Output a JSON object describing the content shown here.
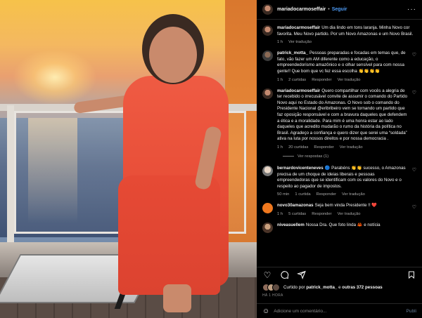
{
  "header": {
    "username": "mariadocarmoseffair",
    "separator": "•",
    "follow_label": "Seguir",
    "more_label": "···"
  },
  "comments": [
    {
      "username": "mariadocarmoseffair",
      "text": "Um dia lindo em tons laranja. Minha Novo cor favorita. Meu Novo partido. Por um Novo Amazonas e um Novo Brasil.",
      "time": "1 h",
      "likes": "",
      "reply_label": "",
      "translate_label": "Ver tradução",
      "avatar": "user"
    },
    {
      "username": "patrick_motta_",
      "text": "Pessoas preparadas e focadas em temas que, de fato, vão fazer um AM diferente como a educação, o empreendedorismo amazônico e o olhar sensível para com nossa gente!! Que bom que vc fez essa escolha 👏👏👏👏",
      "time": "1 h",
      "likes": "2 curtidas",
      "reply_label": "Responder",
      "translate_label": "Ver tradução",
      "avatar": "patrick"
    },
    {
      "username": "mariadocarmoseffair",
      "text": "Quero compartilhar com vocês a alegria de ter recebido o irrecusável convite de assumir o comando do Partido Novo aqui no Estado do Amazonas. O Novo sob o comando do Presidente Nacional @eribribeiro vem se tornando um partido que faz oposição responsável e com a bravura daqueles que defendem a ética e a moralidade. Para mim é uma honra estar ao lado daqueles que acredito mudarão o rumo da história da política no Brasil. Agradeço a confiança e quero dizer que serei uma “soldada” ativa na luta por nossos direitos e por nossa democracia .",
      "time": "1 h",
      "likes": "20 curtidas",
      "reply_label": "Responder",
      "translate_label": "Ver tradução",
      "avatar": "user"
    },
    {
      "username": "bernardovicenteneves",
      "text": "🔵 Parabéns 👏👏 sucesso, o Amazonas precisa de um choque de ideias liberais e pessoas empreendedoras que se identificam com os valores do Novo e o respeito ao pagador de impostos.",
      "time": "50 min",
      "likes": "1 curtida",
      "reply_label": "Responder",
      "translate_label": "Ver tradução",
      "avatar": "bernardo"
    },
    {
      "username": "novo30amazonas",
      "text": "Seja bem vinda Presidente !! ❤️",
      "time": "1 h",
      "likes": "5 curtidas",
      "reply_label": "Responder",
      "translate_label": "Ver tradução",
      "avatar": "novo"
    },
    {
      "username": "niveasuellem",
      "text": "Nossa Dra. Que foto linda 🦀 e notícia",
      "time": "",
      "likes": "",
      "reply_label": "",
      "translate_label": "",
      "avatar": "nivea"
    }
  ],
  "view_replies_label": "Ver respostas (1)",
  "actions": {
    "like_icon": "heart-icon",
    "comment_icon": "comment-icon",
    "share_icon": "share-icon",
    "save_icon": "bookmark-icon"
  },
  "likes_summary": {
    "prefix": "Curtido por",
    "user": "patrick_motta_",
    "middle": "e",
    "others": "outras 372 pessoas"
  },
  "post_time": "HÁ 1 HORA",
  "add_comment": {
    "placeholder": "Adicione um comentário...",
    "publish_label": "Publi"
  }
}
